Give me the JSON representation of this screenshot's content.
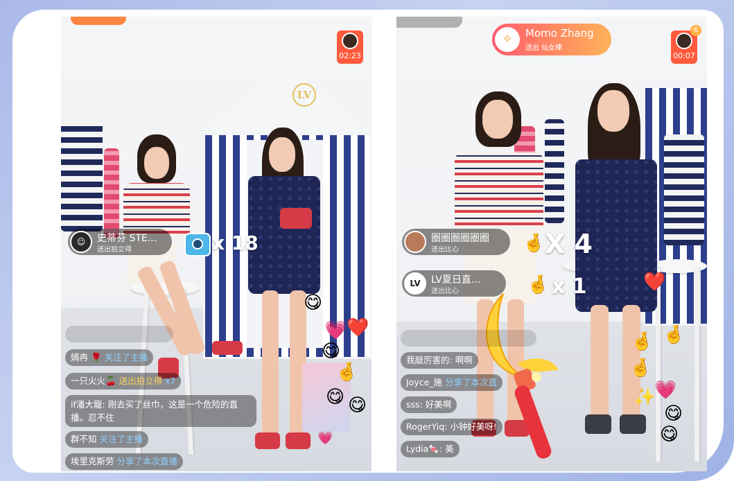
{
  "left": {
    "timer": "02:23",
    "gift": {
      "user": "史蒂芬 STE...",
      "action": "送出拍立得",
      "count": "x 18"
    },
    "comments": [
      {
        "user": "嫣冉",
        "icon": "🌹",
        "action": "关注了主播"
      },
      {
        "user": "一只火火",
        "icon": "🍒",
        "action": "送出拍立得",
        "extra": "x7"
      },
      {
        "user": "if潘大寵",
        "text": "刚去买了丝巾，这是一个危险的直播。忍不住"
      },
      {
        "user": "群不知",
        "action": "关注了主播"
      },
      {
        "user": "埃里克斯劳",
        "action": "分享了本次直播"
      }
    ]
  },
  "right": {
    "timer": "00:07",
    "timer_badge": "6",
    "top_gift": {
      "user": "Momo Zhang",
      "action": "送出 仙女棒"
    },
    "gifts": [
      {
        "user": "圈圈圈圈圈圈",
        "action": "送出比心",
        "count": "X 4"
      },
      {
        "user": "LV夏日直...",
        "action": "送出比心",
        "count": "x 1",
        "avatar": "LV"
      }
    ],
    "comments": [
      {
        "user": "我敲厉害的",
        "text": "啊啊"
      },
      {
        "user": "Joyce_施",
        "action": "分享了本次直"
      },
      {
        "user": "sss",
        "text": "好美啊"
      },
      {
        "user": "RogerYiq",
        "text": "小钟好美呀!"
      },
      {
        "user": "Lydia",
        "icon": "🍬",
        "text": "美"
      }
    ]
  },
  "colors": {
    "accent_orange": "#ff5a3c",
    "action_blue": "#8fd0ff",
    "gift_yellow": "#ffd25a"
  }
}
